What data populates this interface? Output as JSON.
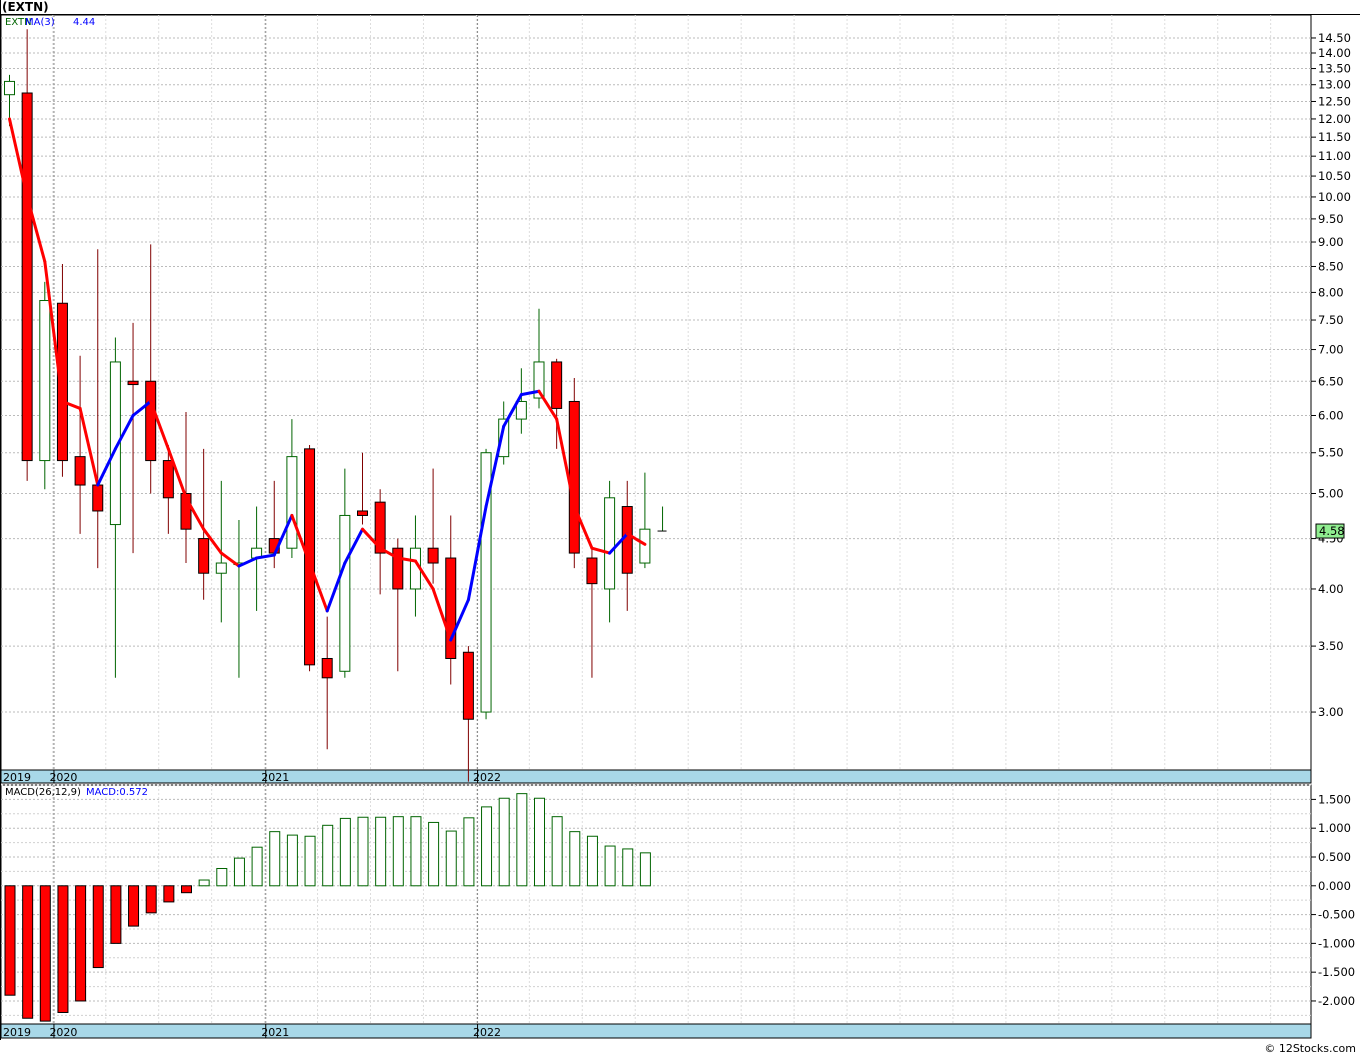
{
  "title": "(EXTN)",
  "credit": "© 12Stocks.com",
  "colors": {
    "up": "#006400",
    "down": "#ff0000",
    "ma_up": "#0000ff",
    "ma_down": "#ff0000",
    "macd_pos": "#006400",
    "macd_neg": "#ff0000",
    "axis_band": "#a8d8e8",
    "last_price_box": "#90ee90"
  },
  "chart_data": [
    {
      "type": "candlestick",
      "name": "price",
      "legend": {
        "symbol": "EXTN",
        "ma_label": "MA(3)",
        "ma_value": "4.44"
      },
      "scale": "log",
      "ylim": [
        2.62,
        15.3
      ],
      "y_ticks": [
        "3.00",
        "3.50",
        "4.00",
        "4.50",
        "5.00",
        "5.50",
        "6.00",
        "6.50",
        "7.00",
        "7.50",
        "8.00",
        "8.50",
        "9.00",
        "9.50",
        "10.00",
        "10.50",
        "11.00",
        "11.50",
        "12.00",
        "12.50",
        "13.00",
        "13.50",
        "14.00",
        "14.50"
      ],
      "last_price": "4.58",
      "x_labels": [
        "2019",
        "2020",
        "2021",
        "2022"
      ],
      "x_label_index": [
        0,
        3,
        15,
        27
      ],
      "candles": [
        {
          "o": 12.7,
          "h": 13.3,
          "l": 11.8,
          "c": 13.1
        },
        {
          "o": 12.75,
          "h": 14.8,
          "l": 5.15,
          "c": 5.4
        },
        {
          "o": 5.4,
          "h": 8.2,
          "l": 5.05,
          "c": 7.85
        },
        {
          "o": 7.8,
          "h": 8.55,
          "l": 5.2,
          "c": 5.4
        },
        {
          "o": 5.45,
          "h": 6.9,
          "l": 4.55,
          "c": 5.1
        },
        {
          "o": 5.1,
          "h": 8.85,
          "l": 4.2,
          "c": 4.8
        },
        {
          "o": 4.65,
          "h": 7.2,
          "l": 3.25,
          "c": 6.8
        },
        {
          "o": 6.5,
          "h": 7.45,
          "l": 4.35,
          "c": 6.45
        },
        {
          "o": 6.5,
          "h": 8.95,
          "l": 5.0,
          "c": 5.4
        },
        {
          "o": 5.4,
          "h": 5.6,
          "l": 4.55,
          "c": 4.95
        },
        {
          "o": 5.0,
          "h": 6.05,
          "l": 4.25,
          "c": 4.6
        },
        {
          "o": 4.5,
          "h": 5.55,
          "l": 3.9,
          "c": 4.15
        },
        {
          "o": 4.15,
          "h": 5.15,
          "l": 3.7,
          "c": 4.25
        },
        {
          "o": 4.25,
          "h": 4.7,
          "l": 3.25,
          "c": 4.25
        },
        {
          "o": 4.3,
          "h": 4.85,
          "l": 3.8,
          "c": 4.4
        },
        {
          "o": 4.5,
          "h": 5.15,
          "l": 4.2,
          "c": 4.35
        },
        {
          "o": 4.4,
          "h": 5.95,
          "l": 4.3,
          "c": 5.45
        },
        {
          "o": 5.55,
          "h": 5.6,
          "l": 3.3,
          "c": 3.35
        },
        {
          "o": 3.4,
          "h": 3.75,
          "l": 2.75,
          "c": 3.25
        },
        {
          "o": 3.3,
          "h": 5.3,
          "l": 3.25,
          "c": 4.75
        },
        {
          "o": 4.8,
          "h": 5.5,
          "l": 4.65,
          "c": 4.75
        },
        {
          "o": 4.9,
          "h": 5.05,
          "l": 3.95,
          "c": 4.35
        },
        {
          "o": 4.4,
          "h": 4.5,
          "l": 3.3,
          "c": 4.0
        },
        {
          "o": 4.0,
          "h": 4.75,
          "l": 3.75,
          "c": 4.4
        },
        {
          "o": 4.4,
          "h": 5.3,
          "l": 4.05,
          "c": 4.25
        },
        {
          "o": 4.3,
          "h": 4.75,
          "l": 3.2,
          "c": 3.4
        },
        {
          "o": 3.45,
          "h": 3.5,
          "l": 2.55,
          "c": 2.95
        },
        {
          "o": 3.0,
          "h": 5.55,
          "l": 2.95,
          "c": 5.5
        },
        {
          "o": 5.45,
          "h": 6.2,
          "l": 5.35,
          "c": 5.95
        },
        {
          "o": 5.95,
          "h": 6.7,
          "l": 5.75,
          "c": 6.2
        },
        {
          "o": 6.25,
          "h": 7.7,
          "l": 6.1,
          "c": 6.8
        },
        {
          "o": 6.8,
          "h": 6.85,
          "l": 5.55,
          "c": 6.1
        },
        {
          "o": 6.2,
          "h": 6.55,
          "l": 4.2,
          "c": 4.35
        },
        {
          "o": 4.3,
          "h": 4.4,
          "l": 3.25,
          "c": 4.05
        },
        {
          "o": 4.0,
          "h": 5.15,
          "l": 3.7,
          "c": 4.95
        },
        {
          "o": 4.85,
          "h": 5.15,
          "l": 3.8,
          "c": 4.15
        },
        {
          "o": 4.25,
          "h": 5.25,
          "l": 4.2,
          "c": 4.6
        },
        {
          "o": 4.58,
          "h": 4.85,
          "l": 4.58,
          "c": 4.58
        }
      ],
      "ma3": [
        12.0,
        10.0,
        8.6,
        6.2,
        6.1,
        5.1,
        5.55,
        6.0,
        6.2,
        5.55,
        4.95,
        4.6,
        4.35,
        4.22,
        4.3,
        4.33,
        4.75,
        4.25,
        3.8,
        4.25,
        4.6,
        4.4,
        4.3,
        4.27,
        4.0,
        3.55,
        3.9,
        4.85,
        5.85,
        6.3,
        6.35,
        5.95,
        4.85,
        4.4,
        4.35,
        4.55,
        4.44
      ]
    },
    {
      "type": "bar",
      "name": "macd",
      "legend": {
        "label": "MACD(26,12,9)",
        "value_label": "MACD:0.572"
      },
      "ylim": [
        -2.4,
        1.75
      ],
      "y_ticks": [
        "1.500",
        "1.000",
        "0.500",
        "0.000",
        "-0.500",
        "-1.000",
        "-1.500",
        "-2.000"
      ],
      "x_labels": [
        "2019",
        "2020",
        "2021",
        "2022"
      ],
      "x_label_index": [
        0,
        3,
        15,
        27
      ],
      "values": [
        -1.9,
        -2.3,
        -2.35,
        -2.2,
        -2.0,
        -1.42,
        -1.0,
        -0.7,
        -0.47,
        -0.28,
        -0.12,
        0.1,
        0.3,
        0.48,
        0.67,
        0.94,
        0.88,
        0.86,
        1.05,
        1.17,
        1.19,
        1.19,
        1.2,
        1.2,
        1.1,
        0.95,
        1.18,
        1.37,
        1.52,
        1.6,
        1.52,
        1.2,
        0.94,
        0.86,
        0.69,
        0.64,
        0.572
      ]
    }
  ]
}
